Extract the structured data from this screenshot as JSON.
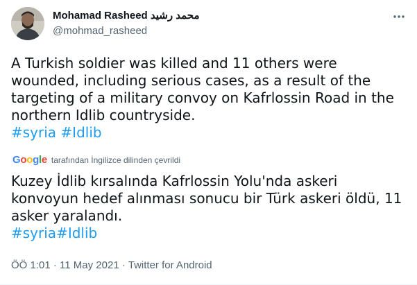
{
  "author": {
    "display_name": "Mohamad Rasheed محمد رشيد",
    "handle": "@mohmad_rasheed"
  },
  "tweet": {
    "text": "A Turkish soldier was killed and 11 others were wounded, including serious cases, as a result of the targeting of a military convoy on Kafrlossin Road in the northern Idlib countryside.",
    "hashtags": [
      "#syria",
      "#Idlib"
    ]
  },
  "translation": {
    "provider": "Google",
    "note": "tarafından İngilizce dilinden çevrildi",
    "text": "Kuzey İdlib kırsalında Kafrlossin Yolu'nda askeri konvoyun hedef alınması sonucu bir Türk askeri öldü, 11 asker yaralandı.",
    "hashtags": [
      "#syria",
      "#Idlib"
    ]
  },
  "meta": {
    "time": "ÖÖ 1:01",
    "separator": "·",
    "date": "11 May 2021",
    "source": "Twitter for Android"
  },
  "icons": {
    "more": "more-options-icon"
  },
  "colors": {
    "link": "#1d9bf0",
    "secondary_text": "#536471",
    "primary_text": "#0f1419"
  }
}
